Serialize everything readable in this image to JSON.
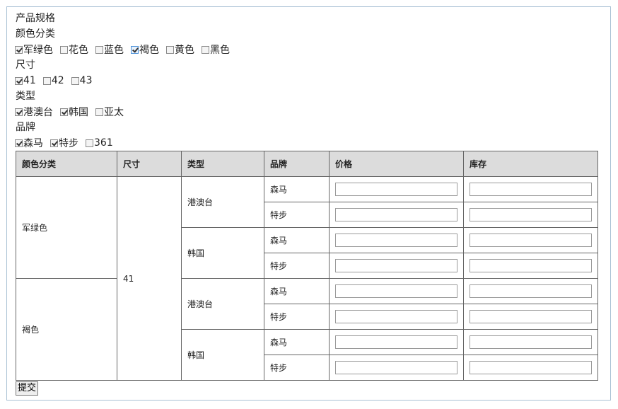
{
  "spec_title": "产品规格",
  "groups": [
    {
      "title": "颜色分类",
      "options": [
        {
          "label": "军绿色",
          "checked": true
        },
        {
          "label": "花色",
          "checked": false
        },
        {
          "label": "蓝色",
          "checked": false
        },
        {
          "label": "褐色",
          "checked": true
        },
        {
          "label": "黄色",
          "checked": false
        },
        {
          "label": "黑色",
          "checked": false
        }
      ]
    },
    {
      "title": "尺寸",
      "options": [
        {
          "label": "41",
          "checked": true
        },
        {
          "label": "42",
          "checked": false
        },
        {
          "label": "43",
          "checked": false
        }
      ]
    },
    {
      "title": "类型",
      "options": [
        {
          "label": "港澳台",
          "checked": true
        },
        {
          "label": "韩国",
          "checked": true
        },
        {
          "label": "亚太",
          "checked": false
        }
      ]
    },
    {
      "title": "品牌",
      "options": [
        {
          "label": "森马",
          "checked": true
        },
        {
          "label": "特步",
          "checked": true
        },
        {
          "label": "361",
          "checked": false
        }
      ]
    }
  ],
  "table": {
    "headers": [
      "颜色分类",
      "尺寸",
      "类型",
      "品牌",
      "价格",
      "库存"
    ],
    "size_value": "41",
    "colors": [
      "军绿色",
      "褐色"
    ],
    "types": [
      "港澳台",
      "韩国",
      "港澳台",
      "韩国"
    ],
    "brands": [
      "森马",
      "特步",
      "森马",
      "特步",
      "森马",
      "特步",
      "森马",
      "特步"
    ]
  },
  "submit_label": "提交"
}
